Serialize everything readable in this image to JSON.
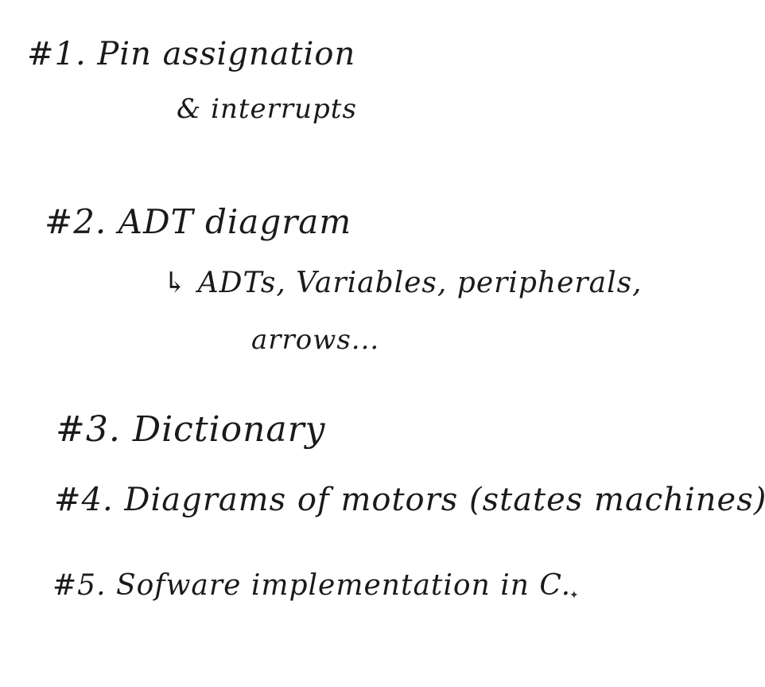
{
  "notes": {
    "line1": "#1. Pin assignation",
    "line2": "& interrupts",
    "line3": "#2. ADT diagram",
    "line4": "↳ ADTs, Variables, peripherals,",
    "line5": "arrows...",
    "line6": "#3. Dictionary",
    "line7": "#4. Diagrams of motors (states machines)",
    "line8": "#5. Sofware implementation in C."
  },
  "ink_color": "#1a1a1a",
  "background_color": "#ffffff",
  "cursor_icon": "sparkle-icon"
}
